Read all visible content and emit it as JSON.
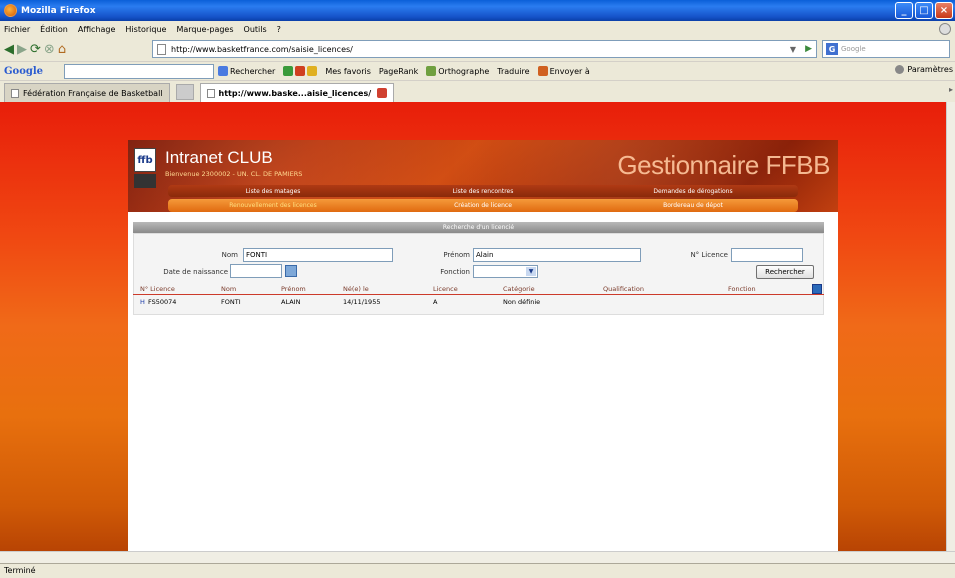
{
  "window": {
    "title": "Mozilla Firefox"
  },
  "menubar": {
    "items": [
      "Fichier",
      "Édition",
      "Affichage",
      "Historique",
      "Marque-pages",
      "Outils",
      "?"
    ]
  },
  "nav": {
    "url": "http://www.basketfrance.com/saisie_licences/",
    "search_placeholder": "Google"
  },
  "google_toolbar": {
    "logo": "Google",
    "items": [
      "Rechercher",
      "Mes favoris",
      "PageRank",
      "Orthographe",
      "Traduire",
      "Envoyer à"
    ],
    "params": "Paramètres"
  },
  "tabs": [
    {
      "label": "Fédération Française de Basketball",
      "active": false
    },
    {
      "label": "http://www.baske...aisie_licences/",
      "active": true
    }
  ],
  "page": {
    "club_title": "Intranet CLUB",
    "club_sub": "Bienvenue 2300002 - UN. CL. DE PAMIERS",
    "brand": "Gestionnaire FFBB",
    "menu_row1": [
      "Liste des matages",
      "Liste des rencontres",
      "Demandes de dérogations"
    ],
    "menu_row2": [
      "Renouvellement des licences",
      "Création de licence",
      "Bordereau de dépot"
    ],
    "search_header": "Recherche d'un licencié",
    "form": {
      "nom_label": "Nom",
      "nom_value": "FONTI",
      "prenom_label": "Prénom",
      "prenom_value": "Alain",
      "licence_label": "N° Licence",
      "licence_value": "",
      "naissance_label": "Date de naissance",
      "naissance_value": "",
      "fonction_label": "Fonction",
      "fonction_value": "",
      "search_button": "Rechercher"
    },
    "table": {
      "headers": [
        "N° Licence",
        "Nom",
        "Prénom",
        "Né(e) le",
        "Licence",
        "Catégorie",
        "Qualification",
        "Fonction"
      ],
      "rows": [
        {
          "flag": "H",
          "licence": "FS50074",
          "nom": "FONTI",
          "prenom": "ALAIN",
          "ne_le": "14/11/1955",
          "licence_type": "A",
          "categorie": "Non définie",
          "qualification": "",
          "fonction": ""
        }
      ]
    }
  },
  "status": {
    "text": "Terminé"
  }
}
